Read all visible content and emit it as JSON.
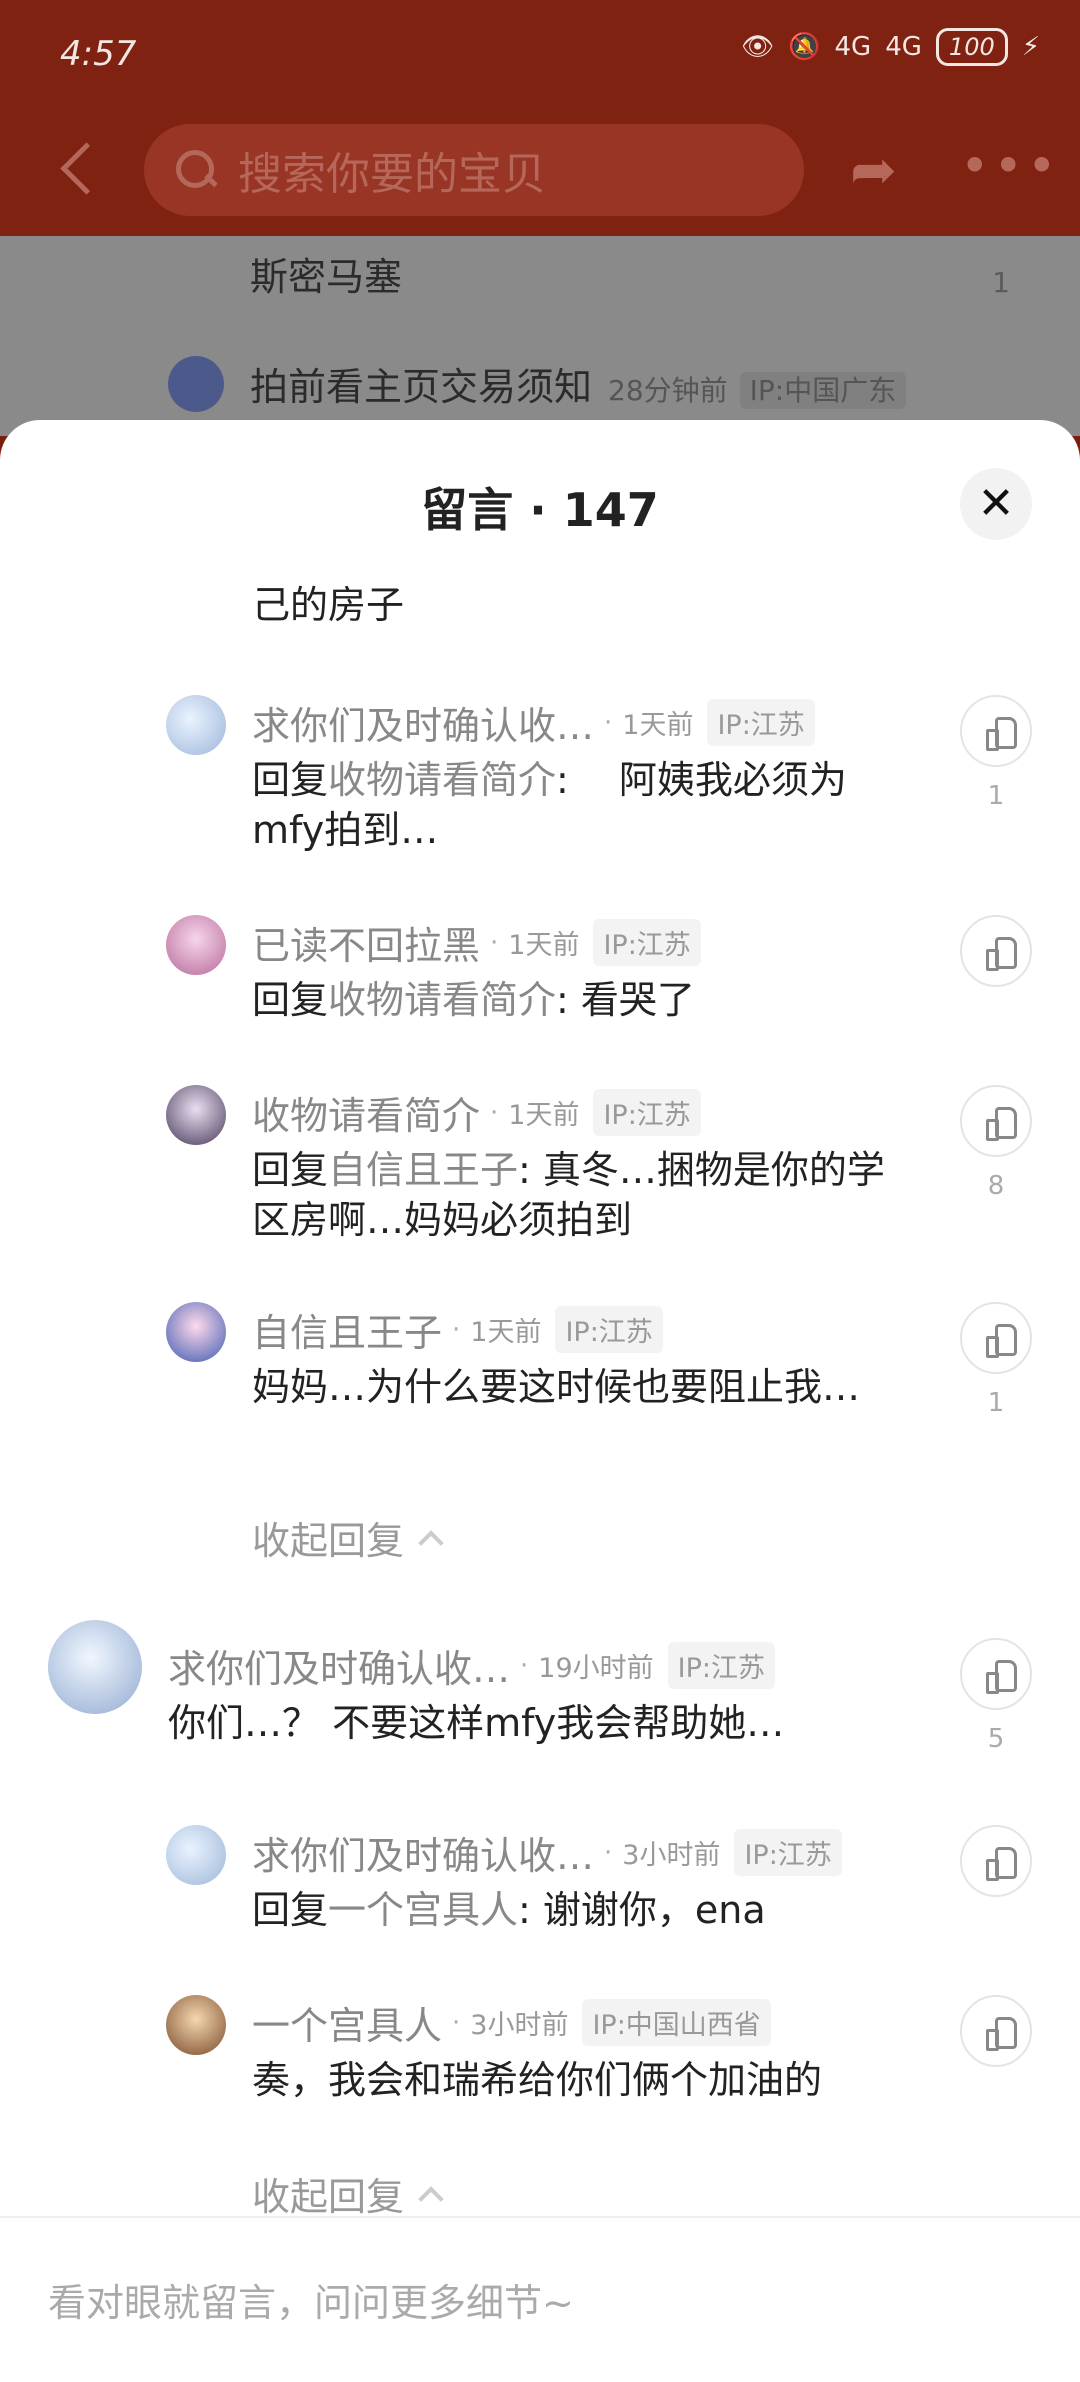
{
  "status": {
    "time": "4:57",
    "signal1": "4G",
    "signal2": "4G",
    "battery": "100"
  },
  "nav": {
    "search_placeholder": "搜索你要的宝贝"
  },
  "background": {
    "row1_text": "斯密马塞",
    "row1_count": "1",
    "row2_name": "拍前看主页交易须知",
    "row2_time": "28分钟前",
    "row2_ip": "IP:中国广东"
  },
  "sheet": {
    "title": "留言 · 147"
  },
  "partial_text": "己的房子",
  "comments": [
    {
      "name": "求你们及时确认收…",
      "time": "1天前",
      "ip": "IP:江苏",
      "reply_prefix": "回复",
      "reply_to": "收物请看简介",
      "text": ":　 阿姨我必须为mfy拍到…",
      "likes": "1"
    },
    {
      "name": "已读不回拉黑",
      "time": "1天前",
      "ip": "IP:江苏",
      "reply_prefix": "回复",
      "reply_to": "收物请看简介",
      "text": ": 看哭了",
      "likes": ""
    },
    {
      "name": "收物请看简介",
      "time": "1天前",
      "ip": "IP:江苏",
      "reply_prefix": "回复",
      "reply_to": "自信且王子",
      "text": ": 真冬…捆物是你的学区房啊…妈妈必须拍到",
      "likes": "8"
    },
    {
      "name": "自信且王子",
      "time": "1天前",
      "ip": "IP:江苏",
      "reply_prefix": "",
      "reply_to": "",
      "text": "妈妈…为什么要这时候也要阻止我…",
      "likes": "1"
    },
    {
      "name": "求你们及时确认收…",
      "time": "19小时前",
      "ip": "IP:江苏",
      "reply_prefix": "",
      "reply_to": "",
      "text": "你们…？ 不要这样mfy我会帮助她…",
      "likes": "5"
    },
    {
      "name": "求你们及时确认收…",
      "time": "3小时前",
      "ip": "IP:江苏",
      "reply_prefix": "回复",
      "reply_to": "一个宫具人",
      "text": ": 谢谢你，ena",
      "likes": ""
    },
    {
      "name": "一个宫具人",
      "time": "3小时前",
      "ip": "IP:中国山西省",
      "reply_prefix": "",
      "reply_to": "",
      "text": "奏，我会和瑞希给你们俩个加油的",
      "likes": ""
    }
  ],
  "collapse_label": "收起回复",
  "input": {
    "placeholder": "看对眼就留言，问问更多细节~"
  },
  "colors": {
    "header": "#7f2211",
    "muted": "#888888"
  }
}
